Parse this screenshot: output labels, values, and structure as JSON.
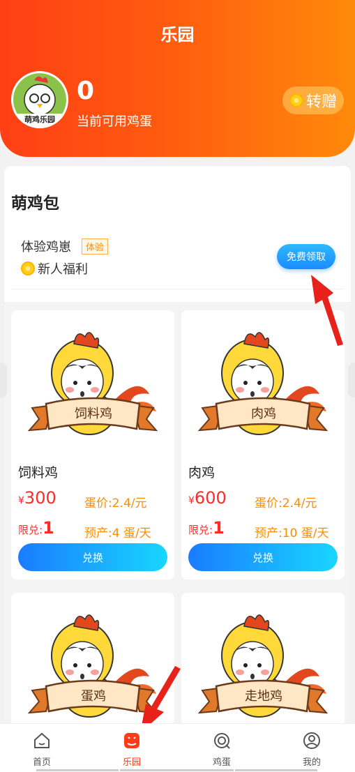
{
  "header": {
    "title": "乐园",
    "egg_count": "0",
    "egg_label": "当前可用鸡蛋",
    "transfer_label": "转赠",
    "avatar_text": "萌鸡乐园"
  },
  "pack": {
    "title": "萌鸡包",
    "trial": {
      "name": "体验鸡崽",
      "tag": "体验",
      "benefit": "新人福利",
      "button": "免费领取"
    }
  },
  "products": [
    {
      "name": "饲料鸡",
      "banner": "饲料鸡",
      "currency": "¥",
      "price": "300",
      "egg_price": "蛋价:2.4/元",
      "limit_label": "限兑:",
      "limit": "1",
      "yield": "预产:4 蛋/天",
      "button": "兑换"
    },
    {
      "name": "肉鸡",
      "banner": "肉鸡",
      "currency": "¥",
      "price": "600",
      "egg_price": "蛋价:2.4/元",
      "limit_label": "限兑:",
      "limit": "1",
      "yield": "预产:10 蛋/天",
      "button": "兑换"
    },
    {
      "banner": "蛋鸡"
    },
    {
      "banner": "走地鸡"
    }
  ],
  "tabbar": [
    {
      "label": "首页",
      "icon": "home-icon"
    },
    {
      "label": "乐园",
      "icon": "park-icon",
      "active": true
    },
    {
      "label": "鸡蛋",
      "icon": "egg-icon"
    },
    {
      "label": "我的",
      "icon": "profile-icon"
    }
  ],
  "colors": {
    "header_start": "#ff3f14",
    "header_end": "#ff8a0a",
    "accent_blue": "#1a8cff",
    "price_red": "#ff2a2a",
    "orange": "#ff8c00"
  }
}
